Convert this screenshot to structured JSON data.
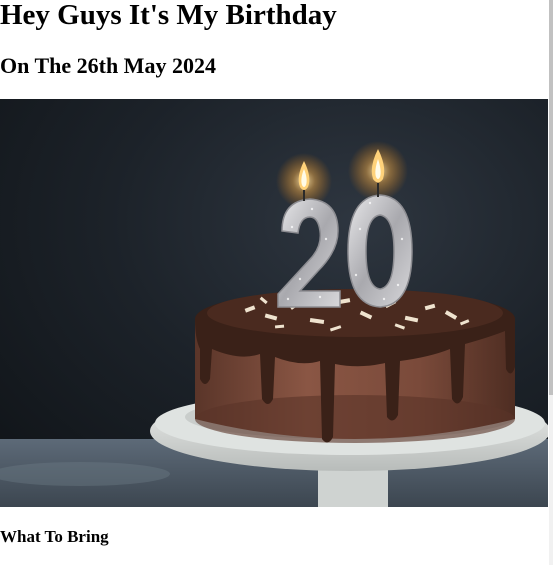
{
  "header": {
    "title": "Hey Guys It's My Birthday",
    "subtitle": "On The 26th May 2024"
  },
  "hero": {
    "image_alt": "Chocolate birthday cake with number 20 candles",
    "candle_number": "20",
    "colors": {
      "background": "#1b2026",
      "cake": "#6b4134",
      "frosting": "#3a2118",
      "stand": "#e3e6e3",
      "candle": "#c9c9cc",
      "flame": "#ffd27a"
    }
  },
  "section": {
    "heading": "What To Bring"
  }
}
